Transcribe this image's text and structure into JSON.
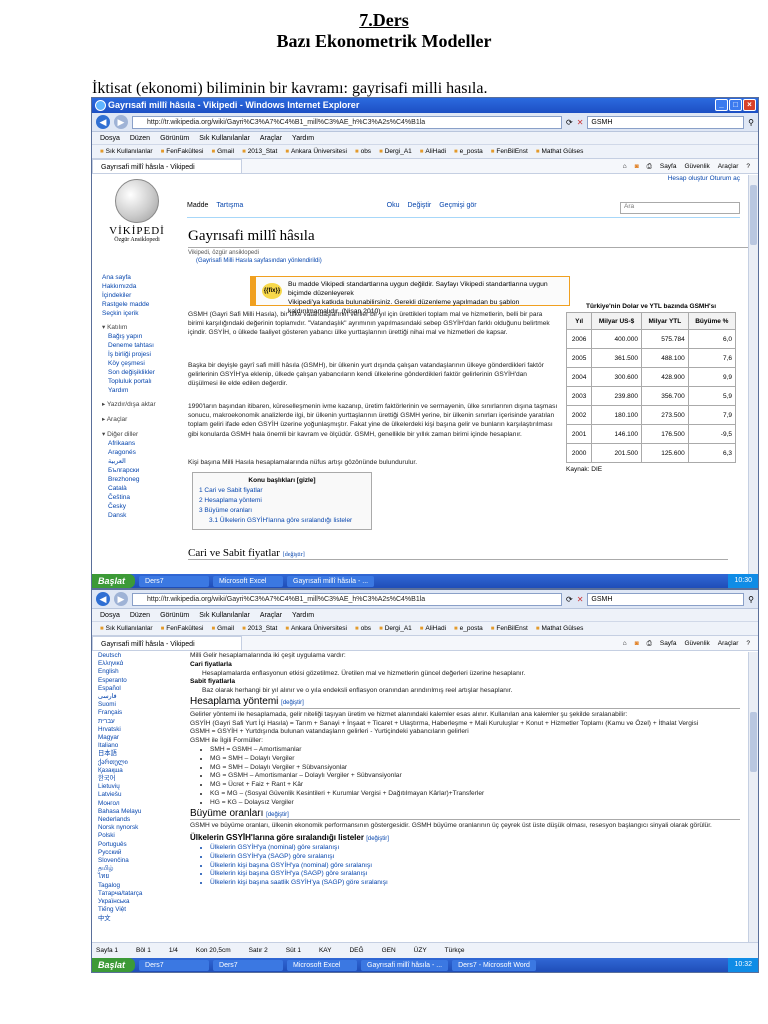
{
  "doc": {
    "lesson": "7.Ders",
    "title": "Bazı Ekonometrik Modeller",
    "intro": "İktisat (ekonomi) biliminin bir kavramı: gayrisafi milli hasıla."
  },
  "window1": {
    "title": "Gayrısafi millî hâsıla - Vikipedi - Windows Internet Explorer",
    "url": "http://tr.wikipedia.org/wiki/Gayri%C3%A7%C4%B1_mill%C3%AE_h%C3%A2s%C4%B1la",
    "search": "GSMH",
    "menu": [
      "Dosya",
      "Düzen",
      "Görünüm",
      "Sık Kullanılanlar",
      "Araçlar",
      "Yardım"
    ],
    "favorites": [
      "Sık Kullanılanlar",
      "FenFakültesi",
      "Gmail",
      "2013_Stat",
      "Ankara Üniversitesi",
      "obs",
      "Dergi_A1",
      "AliHadi",
      "e_posta",
      "FenBilEnst",
      "Mathat Gülses"
    ],
    "tab": "Gayrısafi millî hâsıla - Vikipedi",
    "tools": [
      "Sayfa",
      "Güvenlik",
      "Araçlar"
    ]
  },
  "wiki1": {
    "logo_name": "VİKİPEDİ",
    "logo_sub": "Özgür Ansiklopedi",
    "top_links": "Hesap oluştur  Oturum aç",
    "tabs": [
      "Madde",
      "Tartışma",
      "Oku",
      "Değiştir",
      "Geçmişi gör"
    ],
    "search_placeholder": "Ara",
    "nav": [
      "Ana sayfa",
      "Hakkımızda",
      "İçindekiler",
      "Rastgele madde",
      "Seçkin içerik"
    ],
    "katilim_head": "Katılım",
    "katilim": [
      "Bağış yapın",
      "Deneme tahtası",
      "İş birliği projesi",
      "Köy çeşmesi",
      "Son değişiklikler",
      "Topluluk portalı",
      "Yardım"
    ],
    "print_head": "Yazdır/dışa aktar",
    "tools_head": "Araçlar",
    "lang_head": "Diğer diller",
    "langs": [
      "Afrikaans",
      "Aragonés",
      "العربية",
      "Български",
      "Brezhoneg",
      "Català",
      "Čeština",
      "Česky",
      "Dansk"
    ],
    "page_title": "Gayrısafi millî hâsıla",
    "from": "Vikipedi, özgür ansiklopedi",
    "redirect": "(Gayrisafi Milli Hasıla sayfasından yönlendirildi)",
    "notice_icon": "{{fix}}",
    "notice_line1": "Bu madde Vikipedi standartlarına uygun değildir. Sayfayı Vikipedi standartlarına uygun biçimde düzenleyerek",
    "notice_line2": "Vikipedi'ya katkıda bulunabilirsiniz. Gerekli düzenleme yapılmadan bu şablon kaldırılmamalıdır. (Nisan 2010)",
    "p1": "GSMH (Gayri Safi Milli Hasıla), bir ülke vatandaşlarının veriler bir yıl için ürettikleri toplam mal ve hizmetlerin, belli bir para birimi karşılığındaki değerinin toplamıdır. \"Vatandaşlık\" ayrımının yapılmasındaki sebep GSYİH'dan farklı olduğunu belirtmek içindir. GSYİH, o ülkede faaliyet gösteren yabancı ülke yurttaşlarının ürettiği nihai mal ve hizmetleri de kapsar.",
    "p2": "Başka bir deyişle gayrî safi millî hâsıla (GSMH), bir ülkenin yurt dışında çalışan vatandaşlarının ülkeye gönderdikleri faktör gelirlerinin GSYİH'ya eklenip, ülkede çalışan yabancıların kendi ülkelerine gönderdikleri faktör gelirlerinin GSYİH'dan düşülmesi ile elde edilen değerdir.",
    "p3": "1990'ların başından itibaren, küreselleşmenin ivme kazanıp, üretim faktörlerinin ve sermayenin, ülke sınırlarının dışına taşması sonucu, makroekonomik analizlerde ilgi, bir ülkenin yurttaşlarının ürettiği GSMH yerine, bir ülkenin sınırları içerisinde yaratılan toplam geliri ifade eden GSYİH üzerine yoğunlaşmıştır. Fakat yine de ülkelerdeki kişi başına gelir ve bunların karşılaştırılması gibi konularda GSMH hala önemli bir kavram ve ölçüdür. GSMH, genellikle bir yıllık zaman birimi içinde hesaplanır.",
    "p4": "Kişi başına Milli Hasıla hesaplamalarında nüfus artışı gözönünde bulundurulur.",
    "toc_title": "Konu başlıkları [gizle]",
    "toc": [
      "1 Cari ve Sabit fiyatlar",
      "2 Hesaplama yöntemi",
      "3 Büyüme oranları",
      "3.1 Ülkelerin GSYİH'larına göre sıralandığı listeler"
    ],
    "h_cari": "Cari ve Sabit fiyatlar",
    "edit": "[değiştir]",
    "table_caption": "Türkiye'nin Dolar ve YTL bazında GSMH'sı",
    "table_headers": [
      "Yıl",
      "Milyar US-$",
      "Milyar YTL",
      "Büyüme %"
    ],
    "table_rows": [
      [
        "2006",
        "400.000",
        "575.784",
        "6,0"
      ],
      [
        "2005",
        "361.500",
        "488.100",
        "7,6"
      ],
      [
        "2004",
        "300.600",
        "428.900",
        "9,9"
      ],
      [
        "2003",
        "239.800",
        "356.700",
        "5,9"
      ],
      [
        "2002",
        "180.100",
        "273.500",
        "7,9"
      ],
      [
        "2001",
        "146.100",
        "176.500",
        "-9,5"
      ],
      [
        "2000",
        "201.500",
        "125.600",
        "6,3"
      ]
    ],
    "table_source": "Kaynak: DIE"
  },
  "taskbar1": {
    "start": "Başlat",
    "tasks": [
      "Ders7",
      "Microsoft Excel",
      "Gayrısafi millî hâsıla - ..."
    ],
    "clock": "10:30"
  },
  "window2": {
    "url": "http://tr.wikipedia.org/wiki/Gayri%C3%A7%C4%B1_mill%C3%AE_h%C3%A2s%C4%B1la",
    "search": "GSMH",
    "tab": "Gayrısafi millî hâsıla - Vikipedi"
  },
  "wiki2": {
    "langs": [
      "Deutsch",
      "Ελληνικά",
      "English",
      "Esperanto",
      "Español",
      "فارسی",
      "Suomi",
      "Français",
      "עברית",
      "Hrvatski",
      "Magyar",
      "Italiano",
      "日本語",
      "ქართული",
      "Қазақша",
      "한국어",
      "Lietuvių",
      "Latviešu",
      "Монгол",
      "Bahasa Melayu",
      "Nederlands",
      "Norsk nynorsk",
      "Polski",
      "Português",
      "Русский",
      "Slovenčina",
      "தமிழ்",
      "ไทย",
      "Tagalog",
      "Татарча/tatarça",
      "Українська",
      "Tiếng Việt",
      "中文"
    ],
    "l0": "Milli Gelir hesaplamalarında iki çeşit uygulama vardır:",
    "cari_h": "Cari fiyatlarla",
    "cari_t": "Hesaplamalarda enflasyonun etkisi gözetilmez. Üretilen mal ve hizmetlerin güncel değerleri üzerine hesaplanır.",
    "sabit_h": "Sabit fiyatlarla",
    "sabit_t": "Baz olarak herhangi bir yıl alınır ve o yıla endeksli enflasyon oranından arındırılmış reel artışlar hesaplanır.",
    "h_hesap": "Hesaplama yöntemi",
    "hp1": "Gelirler yöntemi ile hesaplamada, gelir niteliği taşıyan üretim ve hizmet alanındaki kalemler esas alınır. Kullanılan ana kalemler şu şekilde sıralanabilir:",
    "hp2": "GSYİH (Gayri Safi Yurt İçi Hasıla) = Tarım + Sanayi + İnşaat + Ticaret + Ulaştırma, Haberleşme + Mali Kuruluşlar + Konut + Hizmetler Toplamı (Kamu ve Özel) + İthalat Vergisi",
    "hp3": "GSMH = GSYİH + Yurtdışında bulunan vatandaşların gelirleri - Yurtiçindeki yabancıların gelirleri",
    "hp4": "GSMH ile İlgili Formüller:",
    "formulas": [
      "SMH = GSMH – Amortismanlar",
      "MG = SMH – Dolaylı Vergiler",
      "MG = SMH – Dolaylı Vergiler + Sübvansiyonlar",
      "MG = GSMH – Amortismanlar – Dolaylı Vergiler + Sübvansiyonlar",
      "MG = Ücret + Faiz + Rant + Kâr",
      "KG = MG – (Sosyal Güvenlik Kesintileri + Kurumlar Vergisi + Dağıtılmayan Kârlar)+Transferler",
      "HG = KG – Dolaysız Vergiler"
    ],
    "h_buyume": "Büyüme oranları",
    "bp": "GSMH ve büyüme oranları, ülkenin ekonomik performansının göstergesidir. GSMH büyüme oranlarının üç çeyrek üst üste düşük olması, resesyon başlangıcı sinyali olarak görülür.",
    "h_list": "Ülkelerin GSYİH'larına göre sıralandığı listeler",
    "lists": [
      "Ülkelerin GSYİH'ya (nominal) göre sıralanışı",
      "Ülkelerin GSYİH'ya (SAGP) göre sıralanışı",
      "Ülkelerin kişi başına GSYİH'ya (nominal) göre sıralanışı",
      "Ülkelerin kişi başına GSYİH'ya (SAGP) göre sıralanışı",
      "Ülkelerin kişi başına saatlik GSYİH'ya (SAGP) göre sıralanışı"
    ],
    "edit": "[değiştir]"
  },
  "status2": [
    "Sayfa 1",
    "Böl 1",
    "1/4",
    "Kon 20,5cm",
    "Satır 2",
    "Süt 1",
    "KAY",
    "DEĞ",
    "GEN",
    "ÜZY",
    "Türkçe"
  ],
  "taskbar2": {
    "start": "Başlat",
    "tasks": [
      "Ders7",
      "Ders7",
      "Microsoft Excel",
      "Gayrısafi millî hâsıla - ...",
      "Ders7 - Microsoft Word"
    ],
    "clock": "10:32"
  }
}
